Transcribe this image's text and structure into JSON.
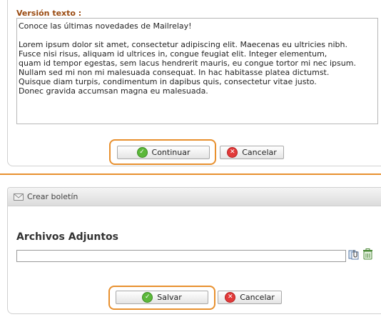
{
  "email_form": {
    "text_version_label": "Versión texto :",
    "text_version_value": "Conoce las últimas novedades de Mailrelay!\n\nLorem ipsum dolor sit amet, consectetur adipiscing elit. Maecenas eu ultricies nibh.\nFusce nisi risus, aliquam id ultrices in, congue feugiat elit. Integer elementum,\nquam id tempor egestas, sem lacus hendrerit mauris, eu congue tortor mi nec ipsum.\nNullam sed mi non mi malesuada consequat. In hac habitasse platea dictumst.\nQuisque diam turpis, condimentum in dapibus quis, consectetur vitae justo.\nDonec gravida accumsan magna eu malesuada.",
    "continue_label": "Continuar",
    "cancel_label": "Cancelar"
  },
  "newsletter_panel": {
    "title": "Crear boletín",
    "attachments_heading": "Archivos Adjuntos",
    "attachment_value": "",
    "save_label": "Salvar",
    "cancel_label": "Cancelar"
  },
  "colors": {
    "highlight": "#e8902e",
    "label": "#9a4a10",
    "ok_icon": "#5cb83a",
    "cancel_icon": "#e23a3a"
  }
}
